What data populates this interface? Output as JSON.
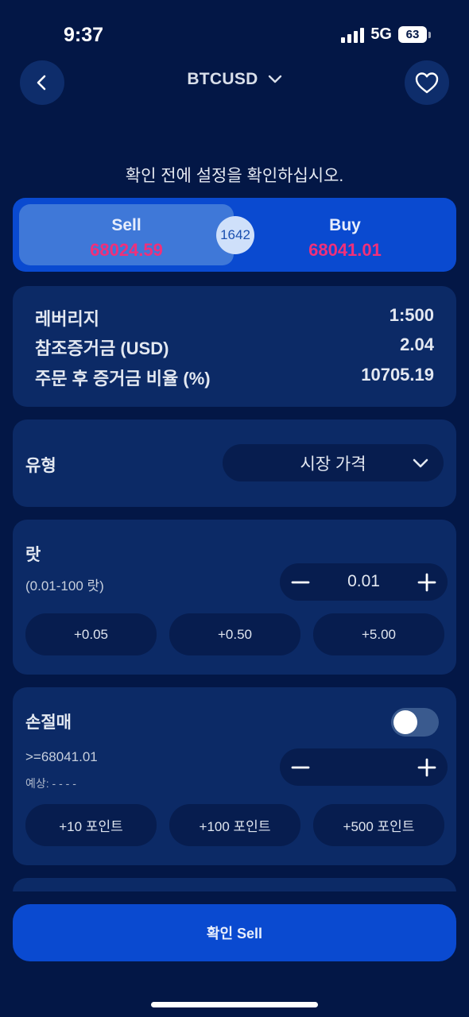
{
  "status": {
    "time": "9:37",
    "network": "5G",
    "battery": "63"
  },
  "header": {
    "symbol": "BTCUSD"
  },
  "prompt": "확인 전에 설정을 확인하십시오.",
  "trade": {
    "sell_label": "Sell",
    "sell_price": "68024.59",
    "buy_label": "Buy",
    "buy_price": "68041.01",
    "spread": "1642"
  },
  "info": {
    "rows": [
      {
        "label": "레버리지",
        "value": "1:500"
      },
      {
        "label": "참조증거금 (USD)",
        "value": "2.04"
      },
      {
        "label": "주문 후 증거금 비율 (%)",
        "value": "10705.19"
      }
    ]
  },
  "order_type": {
    "label": "유형",
    "selected": "시장 가격"
  },
  "lot": {
    "title": "랏",
    "range": "(0.01-100 랏)",
    "value": "0.01",
    "chips": [
      "+0.05",
      "+0.50",
      "+5.00"
    ]
  },
  "stop_loss": {
    "title": "손절매",
    "enabled": false,
    "condition": ">=68041.01",
    "estimate": "예상: - - - -",
    "value": "",
    "chips": [
      "+10 포인트",
      "+100 포인트",
      "+500 포인트"
    ]
  },
  "confirm": {
    "label": "확인 Sell"
  },
  "colors": {
    "background": "#031746",
    "card": "#0c2a66",
    "accent": "#0a4ad0",
    "price": "#f0307a"
  }
}
